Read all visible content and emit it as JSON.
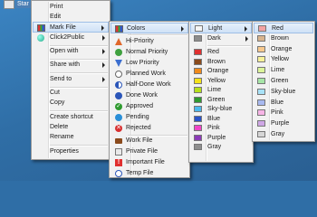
{
  "desktop": {
    "file_label": "Star Ole"
  },
  "context_menu": {
    "items": [
      {
        "label": "Print"
      },
      {
        "label": "Edit"
      },
      {
        "label": "Mark File"
      },
      {
        "label": "Click2Public"
      },
      {
        "label": "Open with"
      },
      {
        "label": "Share with"
      },
      {
        "label": "Send to"
      },
      {
        "label": "Cut"
      },
      {
        "label": "Copy"
      },
      {
        "label": "Create shortcut"
      },
      {
        "label": "Delete"
      },
      {
        "label": "Rename"
      },
      {
        "label": "Properties"
      }
    ]
  },
  "mark_file_menu": {
    "items": [
      {
        "label": "Colors"
      },
      {
        "label": "Hi-Priority"
      },
      {
        "label": "Normal Priority"
      },
      {
        "label": "Low Priority"
      },
      {
        "label": "Planned Work"
      },
      {
        "label": "Half-Done Work"
      },
      {
        "label": "Done Work"
      },
      {
        "label": "Approved"
      },
      {
        "label": "Pending"
      },
      {
        "label": "Rejected"
      },
      {
        "label": "Work File"
      },
      {
        "label": "Private File"
      },
      {
        "label": "Important File"
      },
      {
        "label": "Temp File"
      }
    ]
  },
  "colors_menu": {
    "items": [
      {
        "label": "Light"
      },
      {
        "label": "Dark"
      },
      {
        "label": "Red",
        "color": "#e03030"
      },
      {
        "label": "Brown",
        "color": "#8a4a1c"
      },
      {
        "label": "Orange",
        "color": "#f08a1c"
      },
      {
        "label": "Yellow",
        "color": "#f4e21a"
      },
      {
        "label": "Lime",
        "color": "#b6e01c"
      },
      {
        "label": "Green",
        "color": "#2f9a2f"
      },
      {
        "label": "Sky-blue",
        "color": "#4cb8ec"
      },
      {
        "label": "Blue",
        "color": "#2a52c8"
      },
      {
        "label": "Pink",
        "color": "#ef45c8"
      },
      {
        "label": "Purple",
        "color": "#8c3cb8"
      },
      {
        "label": "Gray",
        "color": "#8e8e8e"
      }
    ]
  },
  "light_menu": {
    "items": [
      {
        "label": "Red",
        "color": "#f3a3a3"
      },
      {
        "label": "Brown",
        "color": "#d8b48e"
      },
      {
        "label": "Orange",
        "color": "#f8c98e"
      },
      {
        "label": "Yellow",
        "color": "#f6f19a"
      },
      {
        "label": "Lime",
        "color": "#dbf59a"
      },
      {
        "label": "Green",
        "color": "#a7e6a7"
      },
      {
        "label": "Sky-blue",
        "color": "#a9e2f7"
      },
      {
        "label": "Blue",
        "color": "#a8b9f0"
      },
      {
        "label": "Pink",
        "color": "#f7b4e6"
      },
      {
        "label": "Purple",
        "color": "#cfa7e6"
      },
      {
        "label": "Gray",
        "color": "#d6d6d6"
      }
    ]
  }
}
